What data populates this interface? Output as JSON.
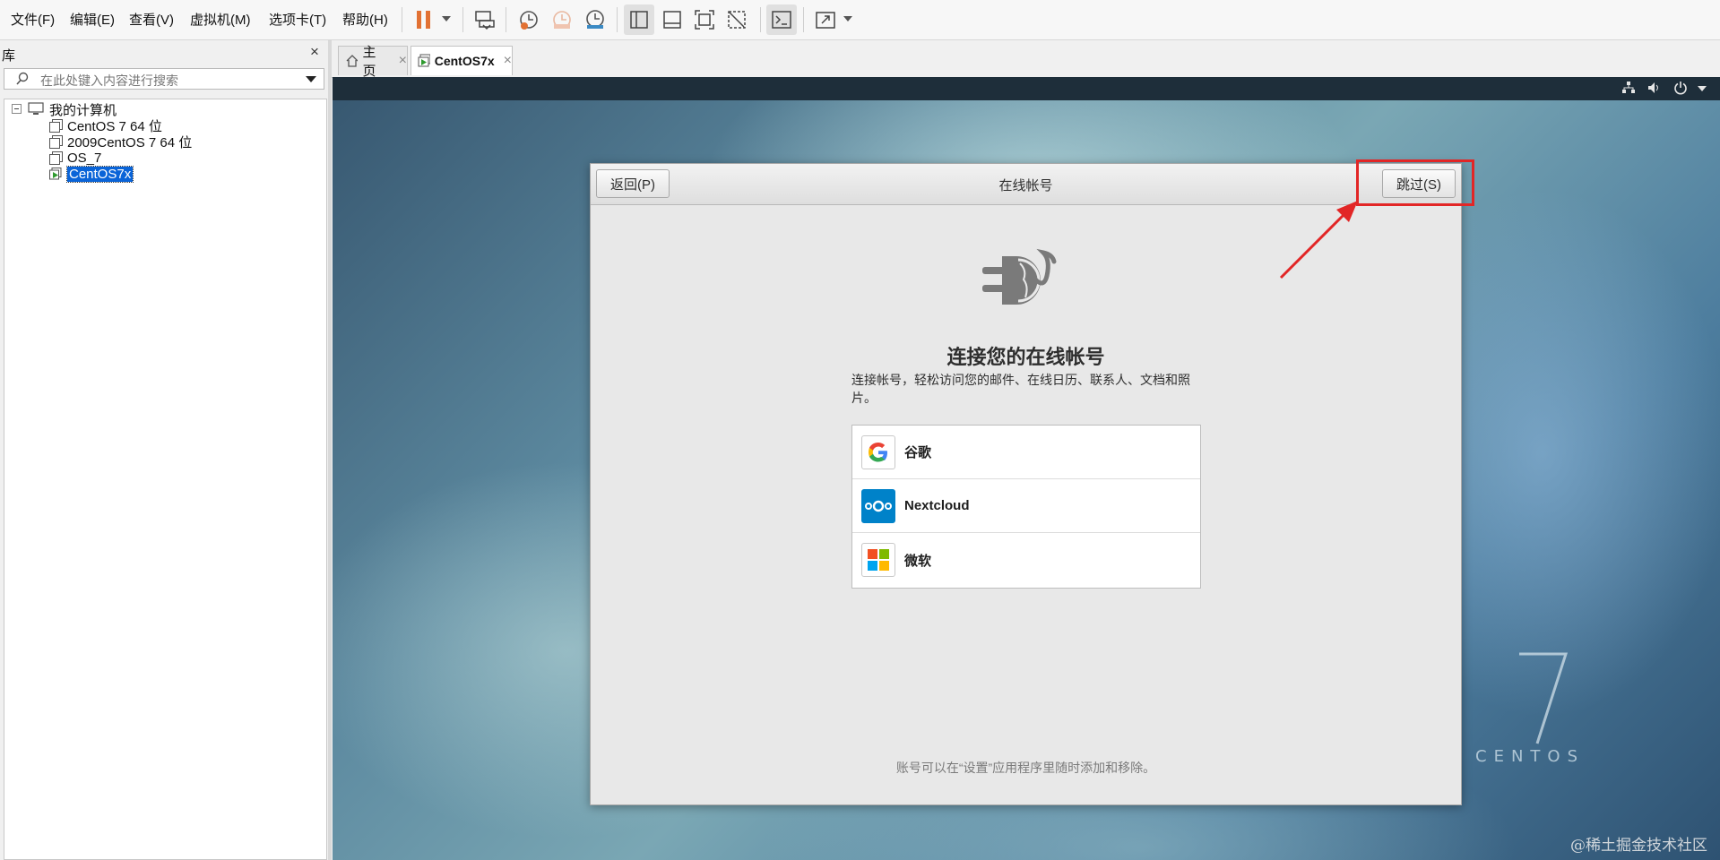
{
  "menubar": {
    "items": [
      "文件(F)",
      "编辑(E)",
      "查看(V)",
      "虚拟机(M)",
      "选项卡(T)",
      "帮助(H)"
    ]
  },
  "toolbar": {
    "icons": [
      "pause-icon",
      "send-keys-icon",
      "snapshot-icon",
      "revert-snapshot-icon",
      "manage-snapshots-icon",
      "library-view-icon",
      "thumbnail-view-icon",
      "fullscreen-icon",
      "unity-icon",
      "console-icon",
      "stretch-icon"
    ],
    "pause_color": "#e27133"
  },
  "library": {
    "title": "库",
    "close_label": "×",
    "search_placeholder": "在此处键入内容进行搜索",
    "root_label": "我的计算机",
    "items": [
      {
        "label": "CentOS 7 64 位"
      },
      {
        "label": "2009CentOS 7 64 位"
      },
      {
        "label": "OS_7"
      },
      {
        "label": "CentOS7x",
        "selected": true
      }
    ]
  },
  "tabs": [
    {
      "label": "主页",
      "close": "×"
    },
    {
      "label": "CentOS7x",
      "close": "×",
      "active": true
    }
  ],
  "guest": {
    "brand_word": "CENTOS",
    "dialog": {
      "back_label": "返回(P)",
      "title": "在线帐号",
      "skip_label": "跳过(S)",
      "heading": "连接您的在线帐号",
      "description": "连接帐号，轻松访问您的邮件、在线日历、联系人、文档和照片。",
      "providers": [
        {
          "name": "谷歌",
          "icon": "google-icon"
        },
        {
          "name": "Nextcloud",
          "icon": "nextcloud-icon"
        },
        {
          "name": "微软",
          "icon": "microsoft-icon"
        }
      ],
      "footer": "账号可以在“设置”应用程序里随时添加和移除。"
    },
    "annotation_color": "#e22626"
  },
  "watermark": "@稀土掘金技术社区"
}
